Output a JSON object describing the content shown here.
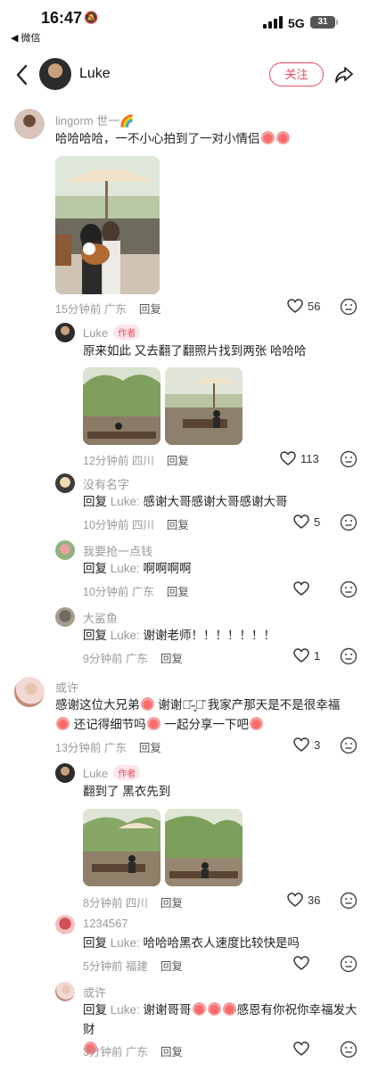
{
  "status_bar": {
    "time": "16:47",
    "back_app": "◀ 微信",
    "network": "5G",
    "battery": "31"
  },
  "header": {
    "name": "Luke",
    "follow_label": "关注"
  },
  "comments": [
    {
      "user": "lingorm 世一🌈",
      "text": "哈哈哈哈，一不小心拍到了一对小情侣",
      "time": "15分钟前 广东",
      "reply": "回复",
      "likes": "56"
    },
    {
      "user": "Luke",
      "tag": "作者",
      "text": "原来如此  又去翻了翻照片找到两张 哈哈哈",
      "time": "12分钟前 四川",
      "reply": "回复",
      "likes": "113"
    },
    {
      "user": "没有名字",
      "reply_prefix": "回复",
      "mention": "Luke:",
      "text": " 感谢大哥感谢大哥感谢大哥",
      "time": "10分钟前 四川",
      "reply": "回复",
      "likes": "5"
    },
    {
      "user": "我要抢一点钱",
      "reply_prefix": "回复",
      "mention": "Luke:",
      "text": " 啊啊啊啊",
      "time": "10分钟前 广东",
      "reply": "回复",
      "likes": ""
    },
    {
      "user": "大鲨鱼",
      "reply_prefix": "回复",
      "mention": "Luke:",
      "text": " 谢谢老师！！！！！！！",
      "time": "9分钟前 广东",
      "reply": "回复",
      "likes": "1"
    },
    {
      "user": "或许",
      "text_line1": "感谢这位大兄弟",
      "text_line1b": " 谢谢ᯅ᷄˶͈ᯅ᷅ 我家产那天是不是很幸福",
      "text_line2": " 还记得细节吗",
      "text_line2b": " 一起分享一下吧",
      "time": "13分钟前 广东",
      "reply": "回复",
      "likes": "3"
    },
    {
      "user": "Luke",
      "tag": "作者",
      "text": "翻到了 黑衣先到",
      "time": "8分钟前 四川",
      "reply": "回复",
      "likes": "36"
    },
    {
      "user": "1234567",
      "reply_prefix": "回复",
      "mention": "Luke:",
      "text": " 哈哈哈黑衣人速度比较快是吗",
      "time": "5分钟前 福建",
      "reply": "回复",
      "likes": ""
    },
    {
      "user": "或许",
      "reply_prefix": "回复",
      "mention": "Luke:",
      "text": " 谢谢哥哥",
      "text_b": "感恩有你祝你幸福发大财",
      "time": "3分钟前 广东",
      "reply": "回复",
      "likes": ""
    }
  ]
}
